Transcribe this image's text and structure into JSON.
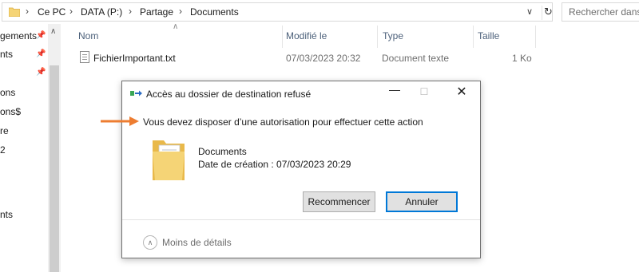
{
  "address_bar": {
    "crumbs": [
      "Ce PC",
      "DATA (P:)",
      "Partage",
      "Documents"
    ],
    "search_placeholder": "Rechercher dans"
  },
  "nav": {
    "items": [
      "gements",
      "nts",
      "",
      "ons",
      "ons$",
      "re",
      "2",
      "nts",
      ""
    ]
  },
  "columns": {
    "name": "Nom",
    "modified": "Modifié le",
    "type": "Type",
    "size": "Taille"
  },
  "files": [
    {
      "name": "FichierImportant.txt",
      "modified": "07/03/2023 20:32",
      "type": "Document texte",
      "size": "1 Ko"
    }
  ],
  "dialog": {
    "title": "Accès au dossier de destination refusé",
    "message": "Vous devez disposer d’une autorisation pour effectuer cette action",
    "item_name": "Documents",
    "item_date": "Date de création : 07/03/2023 20:29",
    "retry_label": "Recommencer",
    "cancel_label": "Annuler",
    "fewer_details": "Moins de détails"
  },
  "colors": {
    "arrow": "#ed7d31",
    "focus_border": "#0078d7",
    "folder": "#f5d476"
  }
}
